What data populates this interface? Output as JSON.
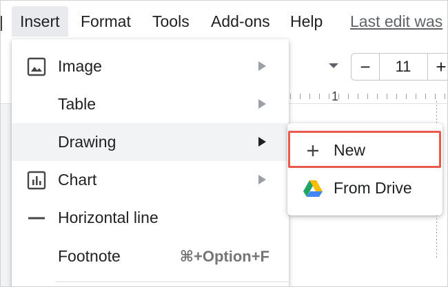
{
  "menubar": {
    "items": [
      "Insert",
      "Format",
      "Tools",
      "Add-ons",
      "Help"
    ],
    "last_edit": "Last edit was"
  },
  "toolbar": {
    "font_size": "11",
    "minus": "−",
    "plus": "+"
  },
  "ruler": {
    "number": "1"
  },
  "insert_menu": {
    "items": [
      {
        "label": "Image",
        "icon": "image-icon",
        "has_submenu": true
      },
      {
        "label": "Table",
        "has_submenu": true
      },
      {
        "label": "Drawing",
        "has_submenu": true,
        "highlighted": true
      },
      {
        "label": "Chart",
        "icon": "chart-icon",
        "has_submenu": true
      },
      {
        "label": "Horizontal line",
        "icon": "horizontal-line-icon"
      },
      {
        "label": "Footnote",
        "shortcut": "⌘+Option+F"
      }
    ]
  },
  "drawing_submenu": {
    "items": [
      {
        "label": "New",
        "icon": "plus-icon",
        "highlighted": true
      },
      {
        "label": "From Drive",
        "icon": "google-drive-icon"
      }
    ]
  },
  "colors": {
    "highlight_outline": "#e8594a",
    "menu_hover": "#f1f3f4",
    "active_menu_bg": "#e8eaed"
  }
}
